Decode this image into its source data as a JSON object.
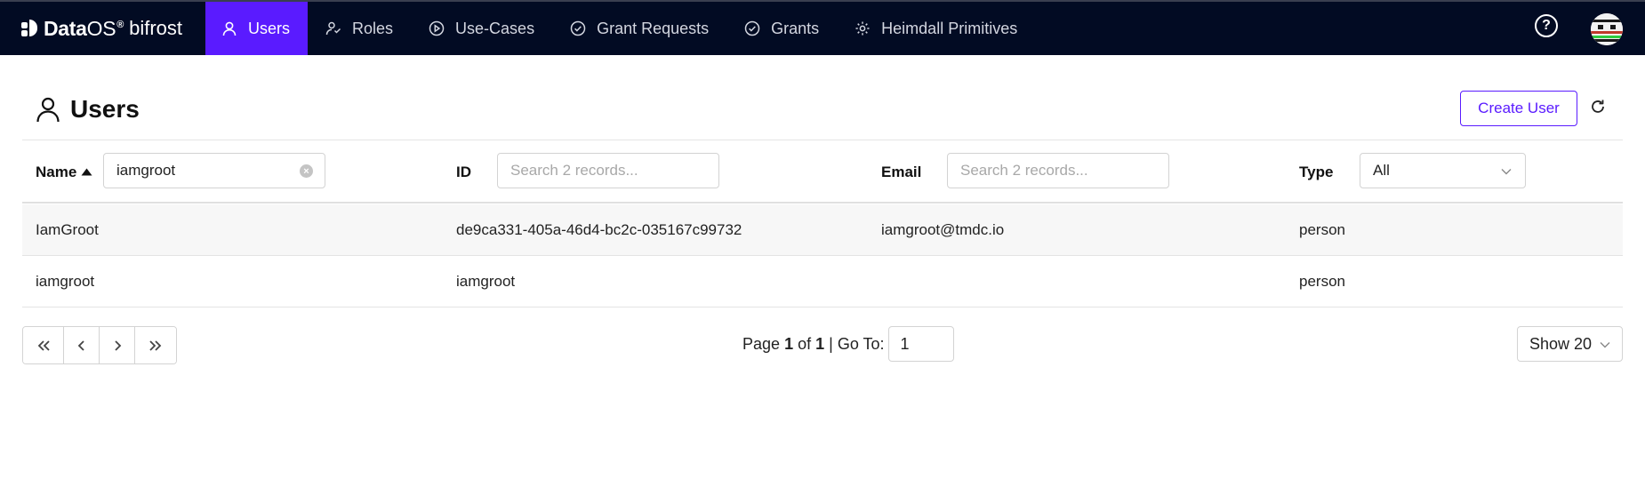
{
  "brand": {
    "name": "Data",
    "os": "OS",
    "registered": "®",
    "product": "bifrost"
  },
  "nav": [
    {
      "label": "Users",
      "icon": "user-icon"
    },
    {
      "label": "Roles",
      "icon": "roles-icon"
    },
    {
      "label": "Use-Cases",
      "icon": "play-circle-icon"
    },
    {
      "label": "Grant Requests",
      "icon": "check-circle-icon"
    },
    {
      "label": "Grants",
      "icon": "check-circle-icon"
    },
    {
      "label": "Heimdall Primitives",
      "icon": "gear-icon"
    }
  ],
  "topbar_right": {
    "help_icon": "help-circle-icon",
    "help_text": "?",
    "avatar_icon": "avatar"
  },
  "page": {
    "title": "Users",
    "title_icon": "user-icon",
    "create_button": "Create User",
    "refresh_icon": "refresh-icon"
  },
  "colors": {
    "nav_bg": "#020b23",
    "accent": "#5a1bff"
  },
  "table": {
    "columns": [
      {
        "label": "Name",
        "sort_icon": "sort-asc-icon",
        "filter_value": "iamgroot",
        "filter_placeholder": ""
      },
      {
        "label": "ID",
        "filter_value": "",
        "filter_placeholder": "Search 2 records..."
      },
      {
        "label": "Email",
        "filter_value": "",
        "filter_placeholder": "Search 2 records..."
      },
      {
        "label": "Type",
        "filter_value": "All",
        "filter_kind": "select"
      }
    ],
    "rows": [
      {
        "name": "IamGroot",
        "id": "de9ca331-405a-46d4-bc2c-035167c99732",
        "email": "iamgroot@tmdc.io",
        "type": "person"
      },
      {
        "name": "iamgroot",
        "id": "iamgroot",
        "email": "",
        "type": "person"
      }
    ]
  },
  "pagination": {
    "page_word": "Page",
    "current": "1",
    "of_word": "of",
    "total": "1",
    "goto_label": "| Go To:",
    "goto_value": "1",
    "show_label": "Show 20"
  }
}
